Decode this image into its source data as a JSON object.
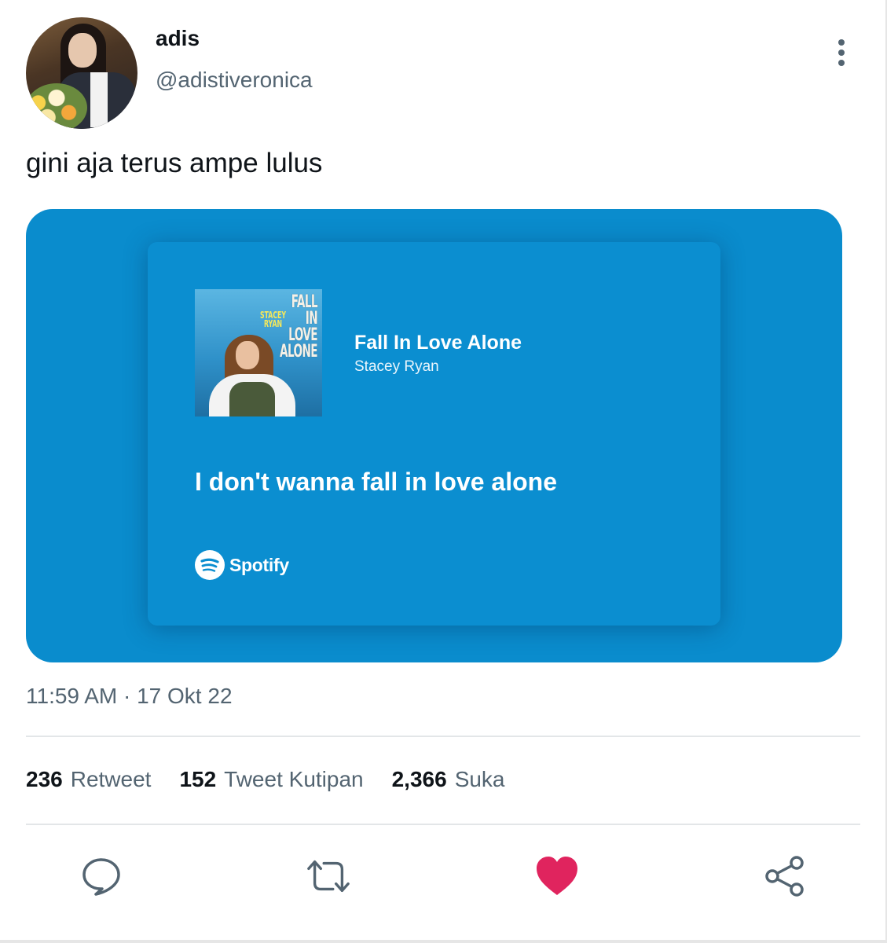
{
  "tweet": {
    "author_name": "adis",
    "author_handle": "@adistiveronica",
    "text": "gini aja terus ampe lulus",
    "timestamp": "11:59 AM · 17 Okt 22"
  },
  "media": {
    "background_color": "#0a8ccd",
    "song_title": "Fall In Love Alone",
    "artist": "Stacey Ryan",
    "lyric": "I don't wanna fall in love alone",
    "album_art_title": "FALL IN LOVE ALONE",
    "album_art_artist": "STACEY RYAN",
    "brand": "Spotify"
  },
  "stats": [
    {
      "count": "236",
      "label": "Retweet"
    },
    {
      "count": "152",
      "label": "Tweet Kutipan"
    },
    {
      "count": "2,366",
      "label": "Suka"
    }
  ],
  "actions": {
    "reply_icon": "speech-bubble",
    "retweet_icon": "retweet-arrows",
    "like_icon": "heart-filled",
    "like_color": "#e0245e",
    "share_icon": "share-nodes"
  }
}
